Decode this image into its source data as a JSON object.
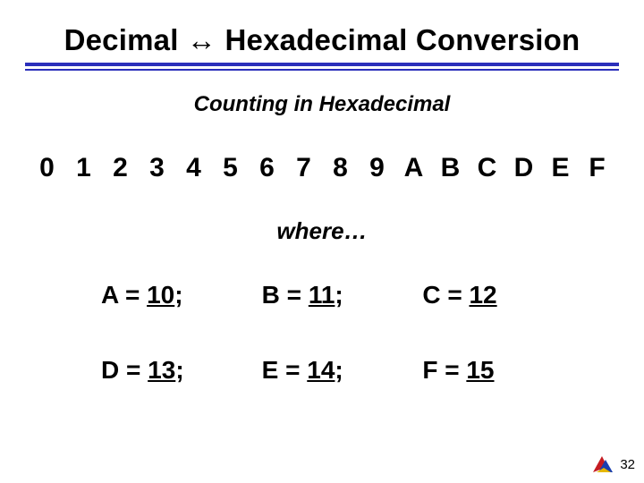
{
  "title": "Decimal ↔ Hexadecimal Conversion",
  "subtitle": "Counting in Hexadecimal",
  "hex_digits": [
    "0",
    "1",
    "2",
    "3",
    "4",
    "5",
    "6",
    "7",
    "8",
    "9",
    "A",
    "B",
    "C",
    "D",
    "E",
    "F"
  ],
  "where_label": "where…",
  "mappings": [
    {
      "letter": "A",
      "value": "10",
      "semi": true
    },
    {
      "letter": "B",
      "value": "11",
      "semi": true
    },
    {
      "letter": "C",
      "value": "12",
      "semi": false
    },
    {
      "letter": "D",
      "value": "13",
      "semi": true
    },
    {
      "letter": "E",
      "value": "14",
      "semi": true
    },
    {
      "letter": "F",
      "value": "15",
      "semi": false
    }
  ],
  "page_number": "32"
}
